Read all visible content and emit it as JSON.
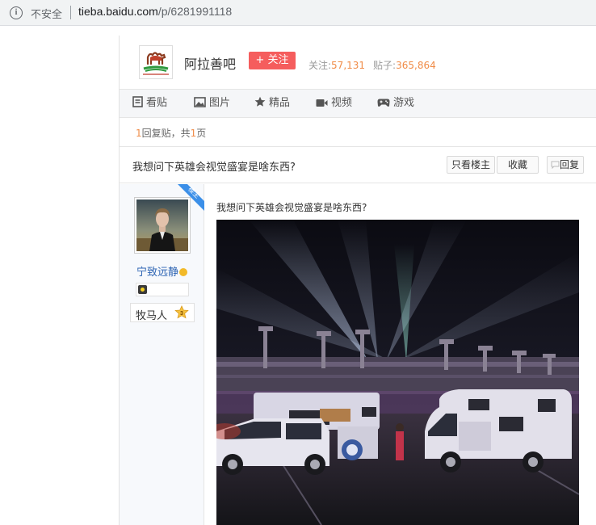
{
  "browser": {
    "security_label": "不安全",
    "url_host": "tieba.baidu.com",
    "url_path": "/p/6281991118"
  },
  "forum": {
    "name": "阿拉善吧",
    "follow_label": "+ 关注",
    "follow_count_label": "关注:",
    "follow_count": "57,131",
    "post_count_label": "贴子:",
    "post_count": "365,864"
  },
  "nav": {
    "items": [
      {
        "label": "看贴",
        "icon": "document-icon"
      },
      {
        "label": "图片",
        "icon": "image-icon"
      },
      {
        "label": "精品",
        "icon": "star-icon"
      },
      {
        "label": "视频",
        "icon": "video-icon"
      },
      {
        "label": "游戏",
        "icon": "gamepad-icon"
      }
    ]
  },
  "thread": {
    "reply_num": "1",
    "reply_text": "回复贴，共",
    "page_num": "1",
    "page_text": "页",
    "title": "我想问下英雄会视觉盛宴是啥东西?",
    "only_op_label": "只看楼主",
    "favorite_label": "收藏",
    "reply_label": "回复"
  },
  "post": {
    "badge": "楼主",
    "username": "宁致远静",
    "user_title": "牧马人",
    "user_level": "3",
    "content": "我想问下英雄会视觉盛宴是啥东西?"
  },
  "colors": {
    "follow_button": "#f55d5d",
    "stat_number": "#f08c48",
    "username": "#2d64b3",
    "badge": "#3b8fe8"
  }
}
